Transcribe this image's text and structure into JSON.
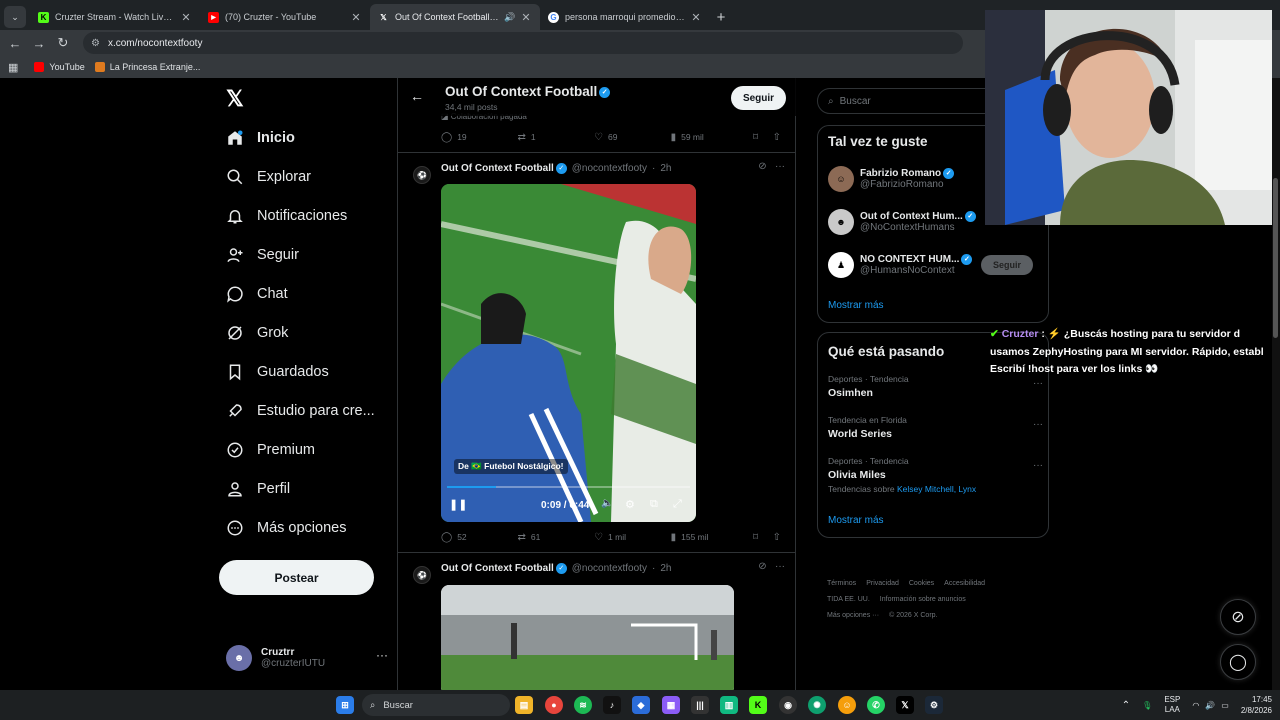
{
  "browser": {
    "tabs": [
      {
        "title": "Cruzter Stream - Watch Live on",
        "favicon_color": "#53fc18",
        "favicon_glyph": "K",
        "active": false,
        "audio": false
      },
      {
        "title": "(70) Cruzter - YouTube",
        "favicon_color": "#ff0000",
        "favicon_glyph": "▶",
        "active": false,
        "audio": false
      },
      {
        "title": "Out Of Context Football (@",
        "favicon_color": "#000000",
        "favicon_glyph": "X",
        "active": true,
        "audio": true
      },
      {
        "title": "persona marroqui promedio - B",
        "favicon_color": "#ffffff",
        "favicon_glyph": "G",
        "active": false,
        "audio": false
      }
    ],
    "url": "x.com/nocontextfooty",
    "bookmarks": [
      {
        "label": "YouTube",
        "color": "#ff0000"
      },
      {
        "label": "La Princesa Extranje...",
        "color": "#e07b1f"
      }
    ]
  },
  "nav": {
    "logo": "X",
    "items": [
      {
        "label": "Inicio",
        "icon": "home-icon"
      },
      {
        "label": "Explorar",
        "icon": "search-icon"
      },
      {
        "label": "Notificaciones",
        "icon": "bell-icon"
      },
      {
        "label": "Seguir",
        "icon": "follow-icon"
      },
      {
        "label": "Chat",
        "icon": "chat-icon"
      },
      {
        "label": "Grok",
        "icon": "grok-icon"
      },
      {
        "label": "Guardados",
        "icon": "bookmark-icon"
      },
      {
        "label": "Estudio para cre...",
        "icon": "rocket-icon"
      },
      {
        "label": "Premium",
        "icon": "verified-icon"
      },
      {
        "label": "Perfil",
        "icon": "person-icon"
      },
      {
        "label": "Más opciones",
        "icon": "more-icon"
      }
    ],
    "post_button": "Postear",
    "account": {
      "name": "Cruztrr",
      "handle": "@cruzterIUTU"
    }
  },
  "profile_header": {
    "title": "Out Of Context Football",
    "posts_count": "34,4 mil posts",
    "follow_label": "Seguir"
  },
  "tweets": [
    {
      "label": "Colaboración pagada",
      "replies": "19",
      "reposts": "1",
      "likes": "69",
      "views": "59 mil"
    },
    {
      "name": "Out Of Context Football",
      "handle": "@nocontextfooty",
      "time": "2h",
      "video": {
        "caption": "De 🇧🇷 Futebol Nostálgico!",
        "time": "0:09 / 0:44",
        "progress": 0.2
      },
      "replies": "52",
      "reposts": "61",
      "likes": "1 mil",
      "views": "155 mil"
    },
    {
      "name": "Out Of Context Football",
      "handle": "@nocontextfooty",
      "time": "2h"
    }
  ],
  "right": {
    "search_placeholder": "Buscar",
    "who_to_follow": {
      "title": "Tal vez te guste",
      "accounts": [
        {
          "name": "Fabrizio Romano",
          "handle": "@FabrizioRomano",
          "follow": ""
        },
        {
          "name": "Out of Context Hum...",
          "handle": "@NoContextHumans",
          "follow": ""
        },
        {
          "name": "NO CONTEXT HUM...",
          "handle": "@HumansNoContext",
          "follow": "Seguir"
        }
      ],
      "more": "Mostrar más"
    },
    "trends": {
      "title": "Qué está pasando",
      "items": [
        {
          "category": "Deportes · Tendencia",
          "name": "Osimhen",
          "sub": ""
        },
        {
          "category": "Tendencia en Florida",
          "name": "World Series",
          "sub": ""
        },
        {
          "category": "Deportes · Tendencia",
          "name": "Olivia Miles",
          "sub_prefix": "Tendencias sobre",
          "sub_links": "Kelsey Mitchell, Lynx"
        }
      ],
      "more": "Mostrar más"
    },
    "footer": {
      "line1": [
        "Términos",
        "Privacidad",
        "Cookies",
        "Accesibilidad"
      ],
      "line2": [
        "TIDA EE. UU.",
        "Información sobre anuncios"
      ],
      "line3": [
        "Más opciones ···",
        "© 2026 X Corp."
      ]
    }
  },
  "chat": {
    "user": "Cruzter",
    "lines": [
      "⚡ ¿Buscás hosting para tu servidor d",
      "usamos ZephyHosting para MI servidor. Rápido, establ",
      "Escribí !host para ver los links 👀"
    ]
  },
  "taskbar": {
    "search": "Buscar",
    "lang": "ESP",
    "lang2": "LAA",
    "time": "17:45",
    "date": "2/8/2026"
  }
}
